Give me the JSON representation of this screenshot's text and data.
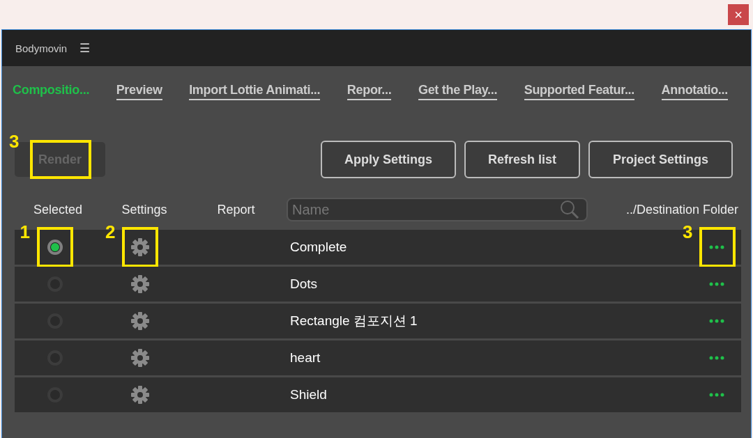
{
  "close_button": "×",
  "panel": {
    "title": "Bodymovin",
    "menu": "☰"
  },
  "tabs": [
    {
      "label": "Compositio...",
      "selected": true
    },
    {
      "label": "Preview",
      "selected": false
    },
    {
      "label": "Import Lottie Animati...",
      "selected": false
    },
    {
      "label": "Repor...",
      "selected": false
    },
    {
      "label": "Get the Play...",
      "selected": false
    },
    {
      "label": "Supported Featur...",
      "selected": false
    },
    {
      "label": "Annotatio...",
      "selected": false
    }
  ],
  "render_button": {
    "label": "Render",
    "disabled": true,
    "callout": "3"
  },
  "buttons": [
    "Apply Settings",
    "Refresh list",
    "Project Settings"
  ],
  "headers": {
    "selected": "Selected",
    "settings": "Settings",
    "report": "Report",
    "search_placeholder": "Name",
    "destination": "../Destination Folder"
  },
  "rows": [
    {
      "name": "Complete",
      "selected": true,
      "radio_callout": "1",
      "gear_callout": "2",
      "more_callout": "3"
    },
    {
      "name": "Dots",
      "selected": false
    },
    {
      "name": "Rectangle 컴포지션 1",
      "selected": false
    },
    {
      "name": "heart",
      "selected": false
    },
    {
      "name": "Shield",
      "selected": false
    }
  ]
}
